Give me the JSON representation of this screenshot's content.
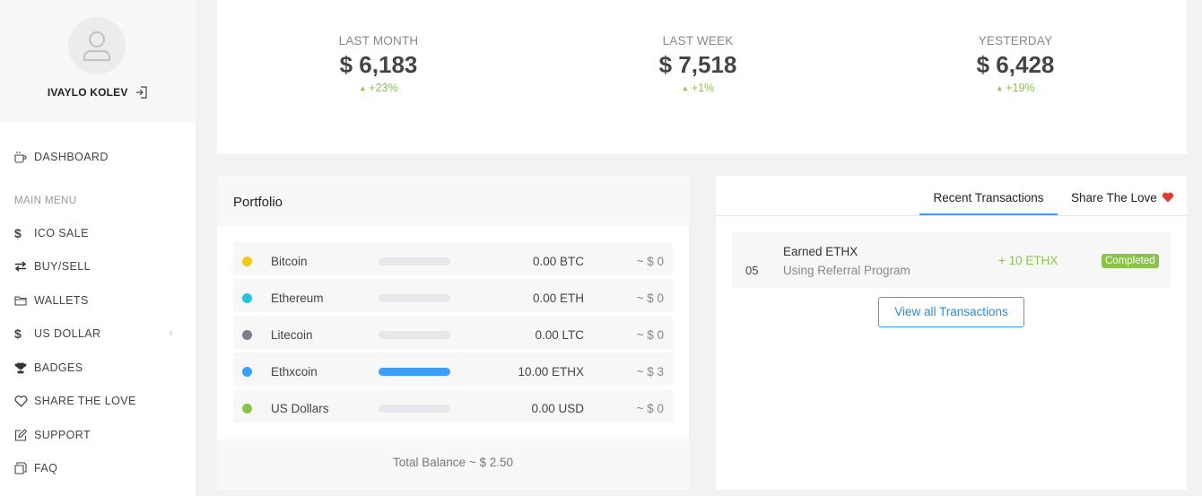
{
  "user": {
    "name": "IVAYLO KOLEV"
  },
  "sidebar": {
    "dashboard": "DASHBOARD",
    "menu_heading": "MAIN MENU",
    "items": [
      {
        "label": "ICO SALE",
        "icon": "dollar-icon"
      },
      {
        "label": "BUY/SELL",
        "icon": "exchange-icon"
      },
      {
        "label": "WALLETS",
        "icon": "folder-icon"
      },
      {
        "label": "US DOLLAR",
        "icon": "dollar-icon"
      },
      {
        "label": "BADGES",
        "icon": "trophy-icon"
      },
      {
        "label": "SHARE THE LOVE",
        "icon": "heart-icon"
      },
      {
        "label": "SUPPORT",
        "icon": "edit-icon"
      },
      {
        "label": "FAQ",
        "icon": "copy-icon"
      }
    ],
    "chevron": "‹"
  },
  "stats": [
    {
      "label": "LAST MONTH",
      "value": "$ 6,183",
      "change": "+23%"
    },
    {
      "label": "LAST WEEK",
      "value": "$ 7,518",
      "change": "+1%"
    },
    {
      "label": "YESTERDAY",
      "value": "$ 6,428",
      "change": "+19%"
    }
  ],
  "portfolio": {
    "title": "Portfolio",
    "rows": [
      {
        "name": "Bitcoin",
        "amount": "0.00 BTC",
        "usd": "~ $ 0",
        "color": "#f5c518",
        "fill": 0
      },
      {
        "name": "Ethereum",
        "amount": "0.00 ETH",
        "usd": "~ $ 0",
        "color": "#26c6da",
        "fill": 0
      },
      {
        "name": "Litecoin",
        "amount": "0.00 LTC",
        "usd": "~ $ 0",
        "color": "#7b7f87",
        "fill": 0
      },
      {
        "name": "Ethxcoin",
        "amount": "10.00 ETHX",
        "usd": "~ $ 3",
        "color": "#3d9ef5",
        "fill": 1
      },
      {
        "name": "US Dollars",
        "amount": "0.00 USD",
        "usd": "~ $ 0",
        "color": "#8bc34a",
        "fill": 0
      }
    ],
    "total": "Total Balance ~ $ 2.50"
  },
  "transactions": {
    "tabs": [
      "Recent Transactions",
      "Share The Love"
    ],
    "items": [
      {
        "num": "05",
        "title": "Earned ETHX",
        "subtitle": "Using Referral Program",
        "amount": "+ 10 ETHX",
        "status": "Completed"
      }
    ],
    "view_all": "View all Transactions"
  }
}
